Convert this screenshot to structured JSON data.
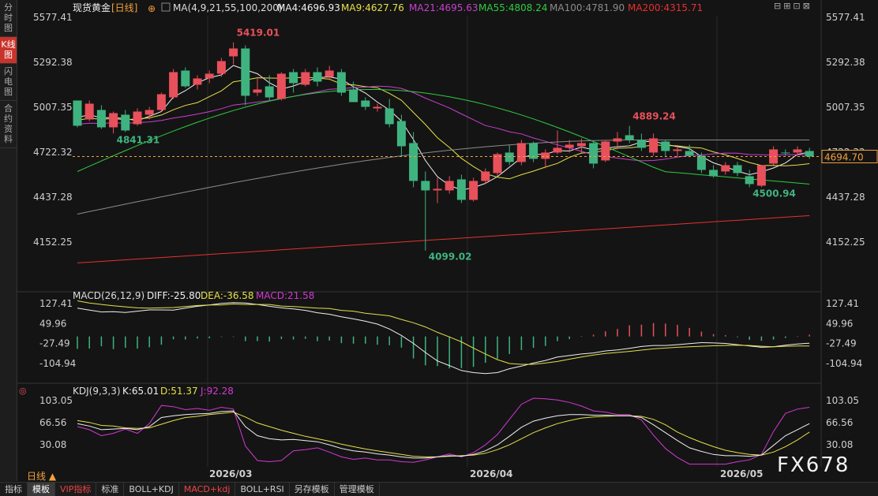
{
  "sidebar": [
    {
      "label": "分时图",
      "active": false
    },
    {
      "label": "K线图",
      "active": true
    },
    {
      "label": "闪电图",
      "active": false
    },
    {
      "label": "合约资料",
      "active": false
    }
  ],
  "header": {
    "symbol": "现货黄金",
    "period_tag": "[日线]",
    "ma_params": "MA(4,9,21,55,100,200)",
    "ma4": "MA4:4696.93",
    "ma9": "MA9:4627.76",
    "ma21": "MA21:4695.63",
    "ma55": "MA55:4808.24",
    "ma100": "MA100:4781.90",
    "ma200": "MA200:4315.71"
  },
  "window_tools": "⊟⊞⊡⊠",
  "macd_header": {
    "title": "MACD(26,12,9)",
    "diff": "DIFF:-25.80",
    "dea": "DEA:-36.58",
    "macd": "MACD:21.58"
  },
  "kdj_header": {
    "title": "KDJ(9,3,3)",
    "k": "K:65.01",
    "d": "D:51.37",
    "j": "J:92.28"
  },
  "period_button": "日线 ▲",
  "bottom_tabs": [
    {
      "label": "指标",
      "state": "normal"
    },
    {
      "label": "模板",
      "state": "active"
    },
    {
      "label": "VIP指标",
      "state": "hl"
    },
    {
      "label": "标准",
      "state": "normal"
    },
    {
      "label": "BOLL+KDJ",
      "state": "normal"
    },
    {
      "label": "MACD+kdj",
      "state": "hl"
    },
    {
      "label": "BOLL+RSI",
      "state": "normal"
    },
    {
      "label": "另存模板",
      "state": "normal"
    },
    {
      "label": "管理模板",
      "state": "normal"
    }
  ],
  "watermark": "FX678",
  "colors": {
    "up": "#e8505b",
    "down": "#3fb37f",
    "ma4": "#f0f0f0",
    "ma9": "#e6e04a",
    "ma21": "#c93fd1",
    "ma55": "#2ecc40",
    "ma100": "#8c8c8c",
    "ma200": "#e83030",
    "dif": "#f0f0f0",
    "dea": "#e6e04a",
    "j": "#d438d4"
  },
  "chart_data": {
    "type": "candlestick",
    "price_ticks": [
      "5577.41",
      "5292.38",
      "5007.35",
      "4722.32",
      "4437.28",
      "4152.25"
    ],
    "price_range": [
      4010,
      5640
    ],
    "last_price": "4694.70",
    "x_labels": [
      "2026/03",
      "2026/04",
      "2026/05"
    ],
    "annotations": [
      {
        "text": "5419.01",
        "type": "high"
      },
      {
        "text": "4841.31",
        "type": "low"
      },
      {
        "text": "4099.02",
        "type": "low"
      },
      {
        "text": "4889.24",
        "type": "high"
      },
      {
        "text": "4500.94",
        "type": "low"
      }
    ],
    "candles": [
      [
        5050,
        5040,
        4880,
        4890
      ],
      [
        4930,
        5050,
        4920,
        5030
      ],
      [
        4990,
        5020,
        4870,
        4880
      ],
      [
        4880,
        4980,
        4841,
        4970
      ],
      [
        4960,
        4990,
        4850,
        4860
      ],
      [
        4900,
        5000,
        4890,
        4980
      ],
      [
        4960,
        5010,
        4930,
        4990
      ],
      [
        4990,
        5100,
        4980,
        5090
      ],
      [
        5070,
        5250,
        5060,
        5230
      ],
      [
        5240,
        5260,
        5130,
        5140
      ],
      [
        5150,
        5210,
        5120,
        5190
      ],
      [
        5190,
        5240,
        5160,
        5220
      ],
      [
        5220,
        5320,
        5200,
        5300
      ],
      [
        5330,
        5419,
        5280,
        5380
      ],
      [
        5380,
        5400,
        5020,
        5080
      ],
      [
        5100,
        5200,
        5080,
        5120
      ],
      [
        5140,
        5210,
        5050,
        5070
      ],
      [
        5060,
        5230,
        5050,
        5220
      ],
      [
        5230,
        5250,
        5100,
        5160
      ],
      [
        5150,
        5250,
        5140,
        5230
      ],
      [
        5230,
        5260,
        5140,
        5170
      ],
      [
        5200,
        5270,
        5180,
        5240
      ],
      [
        5230,
        5250,
        5080,
        5100
      ],
      [
        5120,
        5170,
        5040,
        5040
      ],
      [
        5050,
        5070,
        4990,
        5010
      ],
      [
        5000,
        5030,
        4980,
        5010
      ],
      [
        5000,
        5060,
        4880,
        4900
      ],
      [
        4920,
        4960,
        4700,
        4760
      ],
      [
        4780,
        4850,
        4500,
        4540
      ],
      [
        4540,
        4600,
        4099,
        4480
      ],
      [
        4480,
        4560,
        4400,
        4490
      ],
      [
        4480,
        4570,
        4460,
        4540
      ],
      [
        4550,
        4580,
        4400,
        4420
      ],
      [
        4420,
        4560,
        4410,
        4540
      ],
      [
        4540,
        4620,
        4520,
        4600
      ],
      [
        4590,
        4720,
        4570,
        4710
      ],
      [
        4720,
        4770,
        4640,
        4660
      ],
      [
        4660,
        4800,
        4640,
        4780
      ],
      [
        4780,
        4790,
        4660,
        4680
      ],
      [
        4680,
        4740,
        4620,
        4720
      ],
      [
        4720,
        4860,
        4710,
        4750
      ],
      [
        4750,
        4800,
        4720,
        4770
      ],
      [
        4760,
        4810,
        4720,
        4780
      ],
      [
        4780,
        4790,
        4620,
        4650
      ],
      [
        4670,
        4800,
        4660,
        4790
      ],
      [
        4790,
        4850,
        4740,
        4810
      ],
      [
        4830,
        4889,
        4780,
        4800
      ],
      [
        4800,
        4840,
        4730,
        4750
      ],
      [
        4720,
        4840,
        4700,
        4810
      ],
      [
        4790,
        4800,
        4690,
        4730
      ],
      [
        4730,
        4760,
        4690,
        4740
      ],
      [
        4730,
        4770,
        4690,
        4700
      ],
      [
        4700,
        4720,
        4590,
        4610
      ],
      [
        4610,
        4640,
        4560,
        4570
      ],
      [
        4600,
        4660,
        4580,
        4640
      ],
      [
        4640,
        4660,
        4570,
        4590
      ],
      [
        4570,
        4610,
        4500,
        4520
      ],
      [
        4510,
        4640,
        4500,
        4640
      ],
      [
        4650,
        4760,
        4640,
        4740
      ],
      [
        4720,
        4740,
        4700,
        4715
      ],
      [
        4720,
        4760,
        4700,
        4740
      ],
      [
        4730,
        4750,
        4680,
        4695
      ]
    ],
    "macd": {
      "ticks": [
        "127.41",
        "49.96",
        "-27.49",
        "-104.94"
      ],
      "range": [
        -160,
        150
      ],
      "hist": [
        -48,
        -47,
        -38,
        -49,
        -44,
        -47,
        -42,
        -32,
        -11,
        -12,
        -8,
        -7,
        -2,
        -2,
        -18,
        -18,
        -20,
        -10,
        -12,
        -9,
        -18,
        -16,
        -26,
        -28,
        -28,
        -32,
        -34,
        -43,
        -85,
        -112,
        -115,
        -124,
        -123,
        -118,
        -102,
        -87,
        -68,
        -53,
        -44,
        -37,
        -18,
        -10,
        2,
        7,
        20,
        29,
        43,
        46,
        52,
        50,
        45,
        33,
        19,
        9,
        5,
        -3,
        -13,
        -17,
        -12,
        -6,
        2,
        7
      ],
      "dif": [
        110,
        102,
        95,
        96,
        93,
        98,
        103,
        103,
        102,
        110,
        117,
        122,
        128,
        131,
        130,
        124,
        117,
        111,
        107,
        101,
        92,
        86,
        76,
        68,
        59,
        48,
        29,
        4,
        -27,
        -62,
        -95,
        -113,
        -132,
        -140,
        -144,
        -140,
        -125,
        -115,
        -103,
        -93,
        -80,
        -74,
        -68,
        -64,
        -56,
        -52,
        -46,
        -39,
        -35,
        -35,
        -32,
        -28,
        -24,
        -25,
        -27,
        -32,
        -37,
        -42,
        -40,
        -34,
        -29,
        -26
      ],
      "dea": [
        138,
        130,
        124,
        119,
        115,
        111,
        110,
        111,
        112,
        116,
        120,
        122,
        122,
        126,
        124,
        124,
        124,
        118,
        116,
        113,
        110,
        108,
        101,
        98,
        90,
        85,
        80,
        66,
        53,
        37,
        16,
        -2,
        -21,
        -45,
        -68,
        -90,
        -105,
        -108,
        -108,
        -103,
        -97,
        -88,
        -80,
        -72,
        -66,
        -62,
        -58,
        -53,
        -48,
        -45,
        -42,
        -40,
        -38,
        -36,
        -35,
        -34,
        -35,
        -38,
        -40,
        -38,
        -37,
        -37
      ]
    },
    "kdj": {
      "ticks": [
        "103.05",
        "66.56",
        "30.08"
      ],
      "range": [
        -5,
        115
      ],
      "k": [
        65,
        61,
        55,
        56,
        57,
        55,
        60,
        75,
        78,
        80,
        81,
        82,
        85,
        86,
        60,
        45,
        40,
        38,
        39,
        37,
        35,
        30,
        24,
        20,
        18,
        15,
        13,
        10,
        8,
        8,
        10,
        12,
        11,
        14,
        20,
        30,
        44,
        59,
        69,
        74,
        78,
        80,
        80,
        79,
        79,
        78,
        78,
        75,
        63,
        50,
        37,
        25,
        19,
        14,
        12,
        12,
        11,
        13,
        29,
        45,
        55,
        65
      ],
      "d": [
        70,
        67,
        62,
        61,
        58,
        57,
        58,
        64,
        70,
        75,
        77,
        80,
        82,
        84,
        76,
        66,
        60,
        54,
        49,
        44,
        40,
        36,
        31,
        27,
        23,
        20,
        17,
        14,
        11,
        10,
        10,
        11,
        12,
        13,
        16,
        22,
        30,
        40,
        50,
        58,
        65,
        70,
        74,
        76,
        77,
        78,
        78,
        77,
        72,
        63,
        51,
        42,
        34,
        27,
        21,
        17,
        14,
        13,
        18,
        27,
        38,
        51
      ],
      "j": [
        60,
        55,
        45,
        49,
        56,
        49,
        65,
        95,
        93,
        88,
        90,
        87,
        92,
        89,
        28,
        4,
        2,
        4,
        20,
        22,
        25,
        18,
        10,
        6,
        8,
        5,
        5,
        2,
        1,
        5,
        10,
        15,
        10,
        17,
        30,
        47,
        72,
        97,
        107,
        106,
        104,
        100,
        94,
        86,
        84,
        80,
        80,
        71,
        46,
        24,
        9,
        -8,
        -10,
        -14,
        -6,
        2,
        5,
        14,
        52,
        82,
        89,
        92
      ]
    }
  }
}
